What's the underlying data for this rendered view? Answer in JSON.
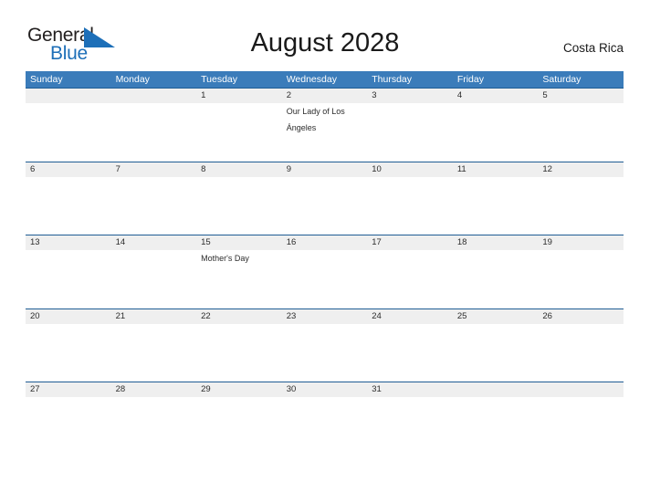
{
  "brand": {
    "word_one": "General",
    "word_two": "Blue",
    "flag_icon": "blue-flag-triangle-icon",
    "color_dark": "#221f1f",
    "color_blue": "#1d6fb8"
  },
  "header": {
    "title": "August 2028",
    "region": "Costa Rica"
  },
  "theme": {
    "header_blue": "#3b7cba",
    "row_rule_blue": "#1f5d94",
    "date_band_gray": "#efefef",
    "text_dark": "#2c2c2c"
  },
  "weekdays": [
    "Sunday",
    "Monday",
    "Tuesday",
    "Wednesday",
    "Thursday",
    "Friday",
    "Saturday"
  ],
  "weeks": [
    {
      "days": [
        {
          "num": "",
          "event": ""
        },
        {
          "num": "",
          "event": ""
        },
        {
          "num": "1",
          "event": ""
        },
        {
          "num": "2",
          "event": "Our Lady of Los Ángeles"
        },
        {
          "num": "3",
          "event": ""
        },
        {
          "num": "4",
          "event": ""
        },
        {
          "num": "5",
          "event": ""
        }
      ]
    },
    {
      "days": [
        {
          "num": "6",
          "event": ""
        },
        {
          "num": "7",
          "event": ""
        },
        {
          "num": "8",
          "event": ""
        },
        {
          "num": "9",
          "event": ""
        },
        {
          "num": "10",
          "event": ""
        },
        {
          "num": "11",
          "event": ""
        },
        {
          "num": "12",
          "event": ""
        }
      ]
    },
    {
      "days": [
        {
          "num": "13",
          "event": ""
        },
        {
          "num": "14",
          "event": ""
        },
        {
          "num": "15",
          "event": "Mother's Day"
        },
        {
          "num": "16",
          "event": ""
        },
        {
          "num": "17",
          "event": ""
        },
        {
          "num": "18",
          "event": ""
        },
        {
          "num": "19",
          "event": ""
        }
      ]
    },
    {
      "days": [
        {
          "num": "20",
          "event": ""
        },
        {
          "num": "21",
          "event": ""
        },
        {
          "num": "22",
          "event": ""
        },
        {
          "num": "23",
          "event": ""
        },
        {
          "num": "24",
          "event": ""
        },
        {
          "num": "25",
          "event": ""
        },
        {
          "num": "26",
          "event": ""
        }
      ]
    },
    {
      "days": [
        {
          "num": "27",
          "event": ""
        },
        {
          "num": "28",
          "event": ""
        },
        {
          "num": "29",
          "event": ""
        },
        {
          "num": "30",
          "event": ""
        },
        {
          "num": "31",
          "event": ""
        },
        {
          "num": "",
          "event": ""
        },
        {
          "num": "",
          "event": ""
        }
      ]
    }
  ]
}
